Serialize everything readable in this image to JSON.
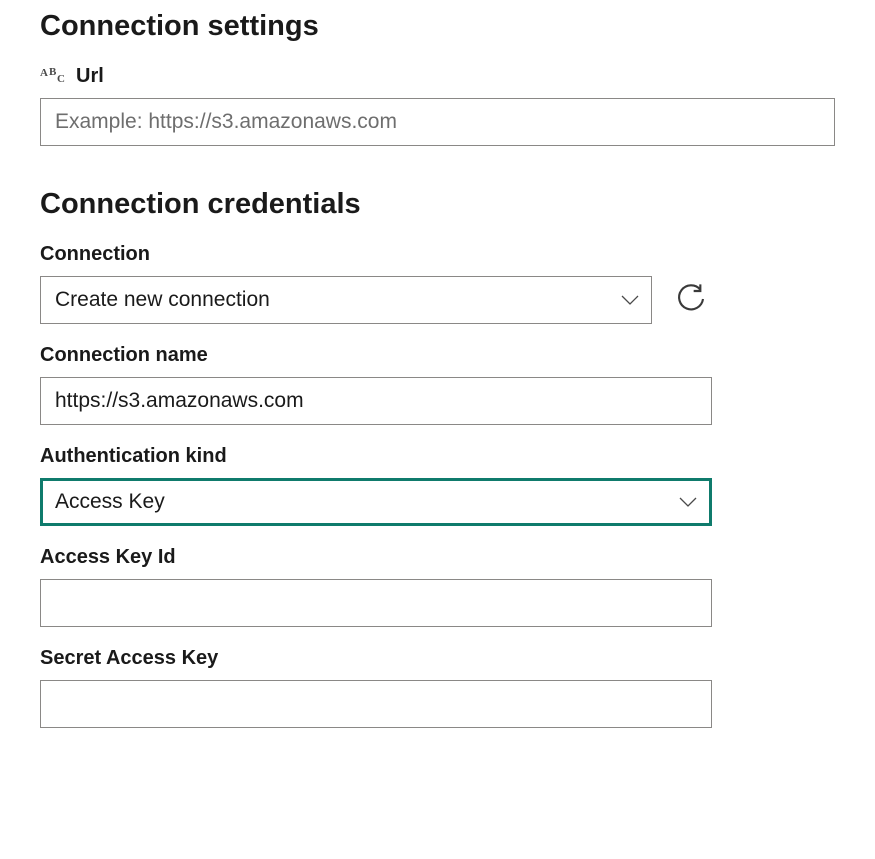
{
  "settings": {
    "title": "Connection settings",
    "url_label": "Url",
    "url_placeholder": "Example: https://s3.amazonaws.com",
    "url_value": ""
  },
  "credentials": {
    "title": "Connection credentials",
    "connection_label": "Connection",
    "connection_selected": "Create new connection",
    "connection_name_label": "Connection name",
    "connection_name_value": "https://s3.amazonaws.com",
    "auth_kind_label": "Authentication kind",
    "auth_kind_selected": "Access Key",
    "access_key_id_label": "Access Key Id",
    "access_key_id_value": "",
    "secret_access_key_label": "Secret Access Key",
    "secret_access_key_value": ""
  },
  "icons": {
    "abc": "abc-type-icon",
    "chevron_down": "chevron-down-icon",
    "refresh": "refresh-icon"
  }
}
